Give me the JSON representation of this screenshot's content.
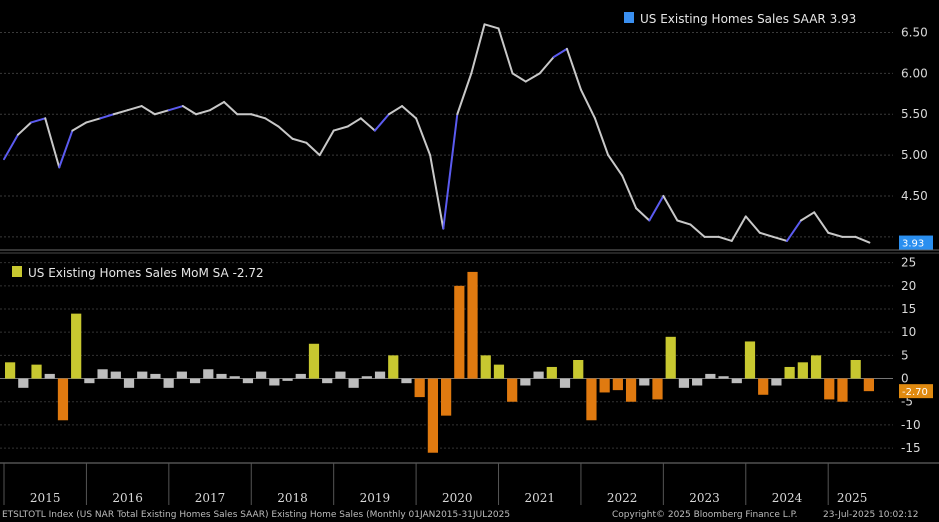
{
  "chart_data": [
    {
      "type": "line",
      "legend": "US Existing Homes Sales SAAR",
      "last_value": "3.93",
      "badge": "3.93",
      "ylim": [
        3.9,
        6.8
      ],
      "yticks": [
        "6.50",
        "6.00",
        "5.50",
        "5.00",
        "4.50"
      ],
      "ytick_values": [
        6.5,
        6.0,
        5.5,
        5.0,
        4.5
      ],
      "colors": {
        "line": "#c8c8c8",
        "up": "#5b5bf0",
        "badge": "#2a8ff0"
      },
      "x": [
        2015.0,
        2015.17,
        2015.33,
        2015.5,
        2015.67,
        2015.83,
        2016.0,
        2016.17,
        2016.33,
        2016.5,
        2016.67,
        2016.83,
        2017.0,
        2017.17,
        2017.33,
        2017.5,
        2017.67,
        2017.83,
        2018.0,
        2018.17,
        2018.33,
        2018.5,
        2018.67,
        2018.83,
        2019.0,
        2019.17,
        2019.33,
        2019.5,
        2019.67,
        2019.83,
        2020.0,
        2020.17,
        2020.33,
        2020.5,
        2020.67,
        2020.83,
        2021.0,
        2021.17,
        2021.33,
        2021.5,
        2021.67,
        2021.83,
        2022.0,
        2022.17,
        2022.33,
        2022.5,
        2022.67,
        2022.83,
        2023.0,
        2023.17,
        2023.33,
        2023.5,
        2023.67,
        2023.83,
        2024.0,
        2024.17,
        2024.33,
        2024.5,
        2024.67,
        2024.83,
        2025.0,
        2025.17,
        2025.33,
        2025.5
      ],
      "y": [
        4.95,
        5.25,
        5.4,
        5.45,
        4.85,
        5.3,
        5.4,
        5.45,
        5.5,
        5.55,
        5.6,
        5.5,
        5.55,
        5.6,
        5.5,
        5.55,
        5.65,
        5.5,
        5.5,
        5.45,
        5.35,
        5.2,
        5.15,
        5.0,
        5.3,
        5.35,
        5.45,
        5.3,
        5.5,
        5.6,
        5.45,
        5.0,
        4.1,
        5.5,
        6.0,
        6.6,
        6.55,
        6.0,
        5.9,
        6.0,
        6.2,
        6.3,
        5.8,
        5.45,
        5.0,
        4.75,
        4.35,
        4.2,
        4.5,
        4.2,
        4.15,
        4.0,
        4.0,
        3.95,
        4.25,
        4.05,
        4.0,
        3.95,
        4.2,
        4.3,
        4.05,
        4.0,
        4.0,
        3.93
      ]
    },
    {
      "type": "bar",
      "legend": "US Existing Homes Sales MoM SA",
      "last_value": "-2.72",
      "badge": "-2.70",
      "ylim": [
        -18,
        26
      ],
      "yticks": [
        "25",
        "20",
        "15",
        "10",
        "5",
        "0",
        "-5",
        "-10",
        "-15"
      ],
      "ytick_values": [
        25,
        20,
        15,
        10,
        5,
        0,
        -5,
        -10,
        -15
      ],
      "colors": {
        "positive": "#c8c830",
        "negative": "#e07a10",
        "small": "#bdbdbd",
        "badge": "#e08a10"
      },
      "values": [
        3.5,
        -2,
        3,
        1,
        -9,
        14,
        -1,
        2,
        1.5,
        -2,
        1.5,
        1,
        -2,
        1.5,
        -1,
        2,
        1,
        0.5,
        -1,
        1.5,
        -1.5,
        -0.5,
        1,
        7.5,
        -1,
        1.5,
        -2,
        0.5,
        1.5,
        5,
        -1,
        -4,
        -16,
        -8,
        20,
        23,
        5,
        3,
        -5,
        -1.5,
        1.5,
        2.5,
        -2,
        4,
        -9,
        -3,
        -2.5,
        -5,
        -1.5,
        -4.5,
        9,
        -2,
        -1.5,
        1,
        0.5,
        -1,
        8,
        -3.5,
        -1.5,
        2.5,
        3.5,
        5,
        -4.5,
        -5,
        4,
        -2.72
      ],
      "x_years": [
        "2015",
        "2016",
        "2017",
        "2018",
        "2019",
        "2020",
        "2021",
        "2022",
        "2023",
        "2024",
        "2025"
      ]
    }
  ],
  "footer": {
    "left": "ETSLTOTL Index (US NAR Total Existing Homes Sales SAAR) Existing Home Sales  (Monthly 01JAN2015-31JUL2025",
    "copyright": "Copyright© 2025 Bloomberg Finance L.P.",
    "date": "23-Jul-2025 10:02:12"
  }
}
